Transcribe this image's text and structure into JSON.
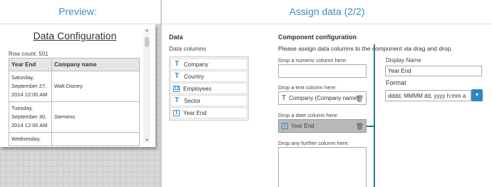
{
  "preview": {
    "title": "Preview:",
    "panel_title": "Data Configuration",
    "row_count": "Row count: 501",
    "headers": [
      "Year End",
      "Company name"
    ],
    "rows": [
      [
        "Saturday, September 27, 2014 12:00 AM",
        "Walt Disney"
      ],
      [
        "Tuesday, September 30, 2014 12:00 AM",
        "Siemens"
      ],
      [
        "Wednesday,",
        ""
      ]
    ]
  },
  "assign": {
    "title": "Assign data (2/2)",
    "data_heading": "Data",
    "data_columns_label": "Data columns",
    "columns": [
      {
        "icon": "T",
        "label": "Company"
      },
      {
        "icon": "T",
        "label": "Country"
      },
      {
        "icon": "12",
        "label": "Employees"
      },
      {
        "icon": "T",
        "label": "Sector"
      },
      {
        "icon": "date",
        "label": "Year End"
      }
    ],
    "component_heading": "Component configuration",
    "instructions": "Please assign data columns to the component via drag and drop.",
    "numeric_label": "Drop a numeric column here:",
    "text_label": "Drop a text column here:",
    "text_value": "Company (Company name)",
    "date_label": "Drop a date column here:",
    "date_value": "Year End",
    "further_label": "Drop any further column here:",
    "display_name_label": "Display Name",
    "display_name_value": "Year End",
    "format_label": "Format",
    "format_value": "dddd, MMMM dd, yyyy h:mm a"
  }
}
